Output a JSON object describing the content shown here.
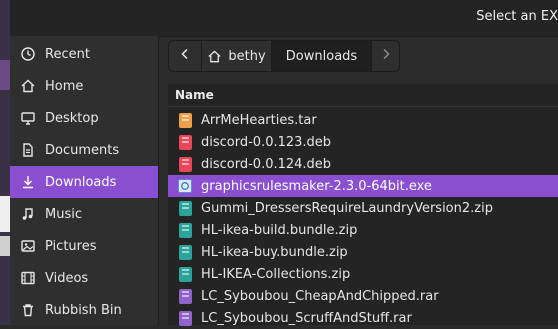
{
  "window": {
    "title": "Select an EX"
  },
  "sidebar": {
    "items": [
      {
        "label": "Recent",
        "icon": "clock-icon"
      },
      {
        "label": "Home",
        "icon": "home-icon"
      },
      {
        "label": "Desktop",
        "icon": "desktop-icon"
      },
      {
        "label": "Documents",
        "icon": "document-icon"
      },
      {
        "label": "Downloads",
        "icon": "download-icon",
        "active": true
      },
      {
        "label": "Music",
        "icon": "music-icon"
      },
      {
        "label": "Pictures",
        "icon": "pictures-icon"
      },
      {
        "label": "Videos",
        "icon": "videos-icon"
      },
      {
        "label": "Rubbish Bin",
        "icon": "trash-icon"
      }
    ]
  },
  "pathbar": {
    "segments": [
      {
        "label": "bethy",
        "icon": "home-icon"
      },
      {
        "label": "Downloads"
      }
    ]
  },
  "file_list": {
    "header": "Name",
    "selected_index": 3,
    "files": [
      {
        "name": "ArrMeHearties.tar",
        "type": "tar"
      },
      {
        "name": "discord-0.0.123.deb",
        "type": "deb"
      },
      {
        "name": "discord-0.0.124.deb",
        "type": "deb"
      },
      {
        "name": "graphicsrulesmaker-2.3.0-64bit.exe",
        "type": "exe"
      },
      {
        "name": "Gummi_DressersRequireLaundryVersion2.zip",
        "type": "zip"
      },
      {
        "name": "HL-ikea-build.bundle.zip",
        "type": "zip"
      },
      {
        "name": "HL-ikea-buy.bundle.zip",
        "type": "zip"
      },
      {
        "name": "HL-IKEA-Collections.zip",
        "type": "zip"
      },
      {
        "name": "LC_Syboubou_CheapAndChipped.rar",
        "type": "rar"
      },
      {
        "name": "LC_Syboubou_ScruffAndStuff.rar",
        "type": "rar"
      }
    ]
  },
  "colors": {
    "accent": "#8a4ed1"
  }
}
